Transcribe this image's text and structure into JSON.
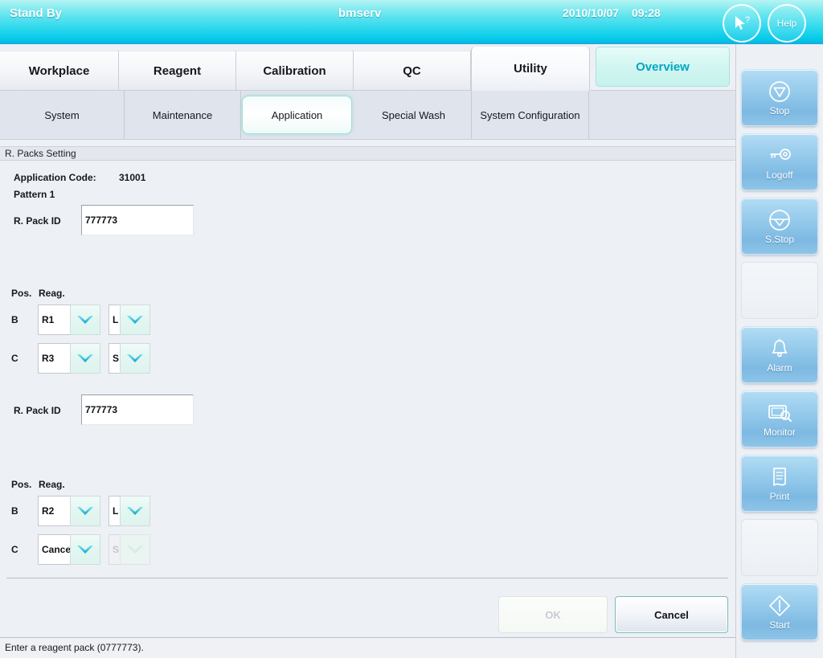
{
  "header": {
    "status": "Stand By",
    "user": "bmserv",
    "date": "2010/10/07",
    "time": "09:28",
    "cursor_help_label": "?",
    "help_label": "Help",
    "gradient_top": "#b6f4f3",
    "gradient_bottom": "#00c6e8"
  },
  "main_tabs": [
    {
      "label": "Workplace"
    },
    {
      "label": "Reagent"
    },
    {
      "label": "Calibration"
    },
    {
      "label": "QC"
    },
    {
      "label": "Utility"
    },
    {
      "label": "Overview"
    }
  ],
  "sub_tabs": [
    {
      "label": "System"
    },
    {
      "label": "Maintenance"
    },
    {
      "label": "Application"
    },
    {
      "label": "Special Wash"
    },
    {
      "label": "System Configuration"
    }
  ],
  "panel": {
    "title": "R. Packs Setting",
    "application_code_label": "Application Code:",
    "application_code_value": "31001",
    "pattern_label": "Pattern 1",
    "pos_header": "Pos.",
    "reag_header": "Reag.",
    "rpack_label": "R. Pack ID"
  },
  "groups": [
    {
      "rpack_id_value": "777773",
      "rows": [
        {
          "pos": "B",
          "reagent": "R1",
          "volume": "L",
          "volume_disabled": false
        },
        {
          "pos": "C",
          "reagent": "R3",
          "volume": "S",
          "volume_disabled": false
        }
      ]
    },
    {
      "rpack_id_value": "777773",
      "rows": [
        {
          "pos": "B",
          "reagent": "R2",
          "volume": "L",
          "volume_disabled": false
        },
        {
          "pos": "C",
          "reagent": "Cancel",
          "volume": "S",
          "volume_disabled": true
        }
      ]
    }
  ],
  "dialog_buttons": {
    "ok_label": "OK",
    "ok_disabled": true,
    "cancel_label": "Cancel",
    "cancel_disabled": false
  },
  "status_bar": {
    "message": "Enter a reagent pack (0777773)."
  },
  "sidebar": [
    {
      "label": "Stop",
      "icon": "stop-icon",
      "empty": false
    },
    {
      "label": "Logoff",
      "icon": "key-icon",
      "empty": false
    },
    {
      "label": "S.Stop",
      "icon": "sstop-icon",
      "empty": false
    },
    {
      "label": "",
      "icon": "",
      "empty": true
    },
    {
      "label": "Alarm",
      "icon": "bell-icon",
      "empty": false
    },
    {
      "label": "Monitor",
      "icon": "monitor-icon",
      "empty": false
    },
    {
      "label": "Print",
      "icon": "printer-icon",
      "empty": false
    },
    {
      "label": "",
      "icon": "",
      "empty": true
    },
    {
      "label": "Start",
      "icon": "start-icon",
      "empty": false
    }
  ],
  "colors": {
    "accent_cyan": "#00c6e8",
    "overview_text": "#00a7c4",
    "panel_bg": "#edf0f5",
    "sidebar_button": "#96cbec"
  }
}
